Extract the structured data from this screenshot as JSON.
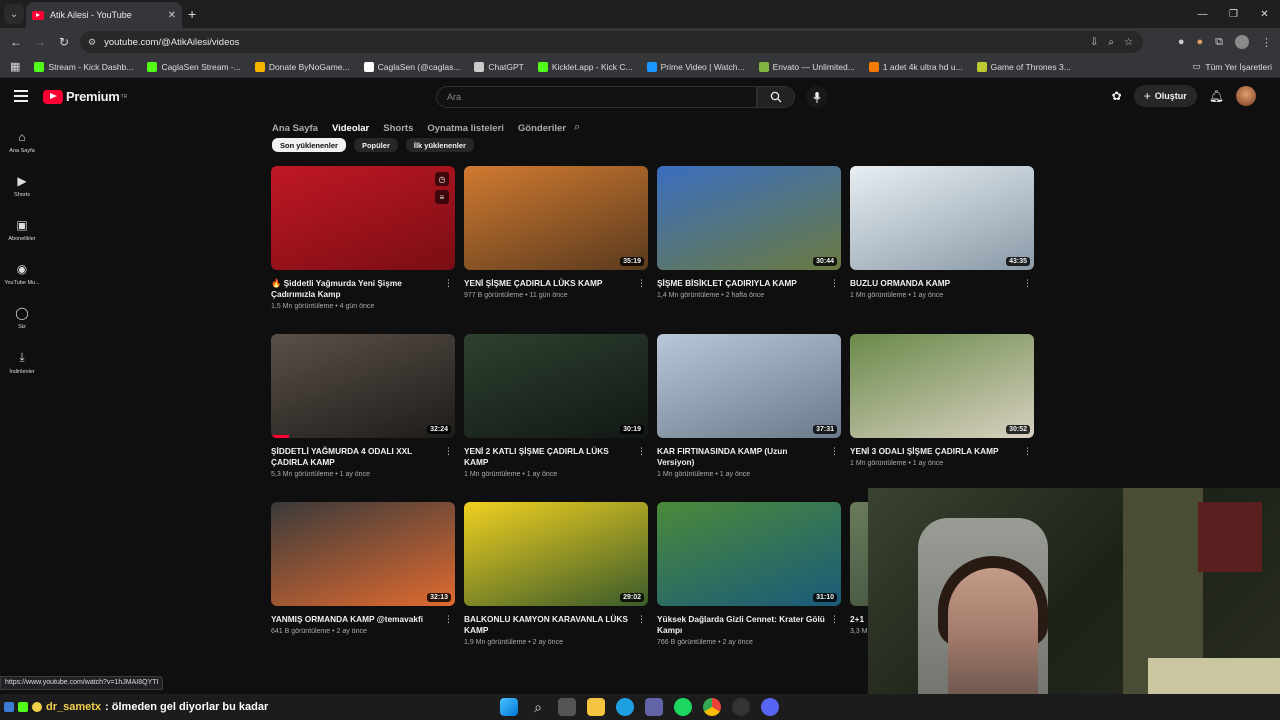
{
  "browser": {
    "tab_title": "Atik Ailesi - YouTube",
    "new_tab": "+",
    "url": "youtube.com/@AtikAilesi/videos",
    "bookmarks": [
      {
        "label": "Stream - Kick Dashb...",
        "color": "#53fc18"
      },
      {
        "label": "CaglaSen Stream -...",
        "color": "#53fc18"
      },
      {
        "label": "Donate ByNoGame...",
        "color": "#f5b400"
      },
      {
        "label": "CaglaSen (@caglas...",
        "color": "#ffffff"
      },
      {
        "label": "ChatGPT",
        "color": "#cccccc"
      },
      {
        "label": "Kicklet.app - Kick C...",
        "color": "#53fc18"
      },
      {
        "label": "Prime Video | Watch...",
        "color": "#1a98ff"
      },
      {
        "label": "Envato — Unlimited...",
        "color": "#82b541"
      },
      {
        "label": "1 adet 4k ultra hd u...",
        "color": "#f57c00"
      },
      {
        "label": "Game of Thrones 3...",
        "color": "#c0ca33"
      }
    ],
    "all_bookmarks": "Tüm Yer İşaretleri"
  },
  "yt": {
    "logo_text": "Premium",
    "logo_sup": "TR",
    "search_placeholder": "Ara",
    "create_label": "Oluştur",
    "guide": [
      {
        "label": "Ana Sayfa",
        "icon": "home-icon"
      },
      {
        "label": "Shorts",
        "icon": "shorts-icon"
      },
      {
        "label": "Abonelikler",
        "icon": "subscriptions-icon"
      },
      {
        "label": "YouTube Mu...",
        "icon": "music-icon"
      },
      {
        "label": "Siz",
        "icon": "you-icon"
      },
      {
        "label": "İndirilenler",
        "icon": "download-icon"
      }
    ],
    "channel_tabs": [
      "Ana Sayfa",
      "Videolar",
      "Shorts",
      "Oynatma listeleri",
      "Gönderiler"
    ],
    "active_tab": "Videolar",
    "chips": [
      "Son yüklenenler",
      "Popüler",
      "İlk yüklenenler"
    ],
    "videos": [
      {
        "title": "🔥 Şiddetli Yağmurda Yeni Şişme Çadırımızla Kamp",
        "views": "1,5 Mn görüntüleme",
        "age": "4 gün önce",
        "duration": "",
        "colors": [
          "#c01824",
          "#7a0d14"
        ]
      },
      {
        "title": "YENİ ŞİŞME ÇADIRLA LÜKS KAMP",
        "views": "977 B görüntüleme",
        "age": "11 gün önce",
        "duration": "35:19",
        "colors": [
          "#d07a30",
          "#5a3a1e"
        ]
      },
      {
        "title": "ŞİŞME BİSİKLET ÇADIRIYLA KAMP",
        "views": "1,4 Mn görüntüleme",
        "age": "2 hafta önce",
        "duration": "30:44",
        "colors": [
          "#3a6ec0",
          "#6b7a40"
        ]
      },
      {
        "title": "BUZLU ORMANDA KAMP",
        "views": "1 Mn görüntüleme",
        "age": "1 ay önce",
        "duration": "43:35",
        "colors": [
          "#e8eef2",
          "#8a9aa8"
        ]
      },
      {
        "title": "ŞİDDETLİ YAĞMURDA 4 ODALI XXL ÇADIRLA KAMP",
        "views": "5,3 Mn görüntüleme",
        "age": "1 ay önce",
        "duration": "32:24",
        "colors": [
          "#5a5048",
          "#1e1c1a"
        ],
        "progress": 0.1
      },
      {
        "title": "YENİ 2 KATLI ŞİŞME ÇADIRLA LÜKS KAMP",
        "views": "1 Mn görüntüleme",
        "age": "1 ay önce",
        "duration": "30:19",
        "colors": [
          "#2e4030",
          "#121814"
        ]
      },
      {
        "title": "KAR FIRTINASINDA KAMP (Uzun Versiyon)",
        "views": "1 Mn görüntüleme",
        "age": "1 ay önce",
        "duration": "37:31",
        "colors": [
          "#b8c8d8",
          "#6a7a8a"
        ]
      },
      {
        "title": "YENİ 3 ODALI ŞİŞME ÇADIRLA KAMP",
        "views": "1 Mn görüntüleme",
        "age": "1 ay önce",
        "duration": "30:52",
        "colors": [
          "#6a8a4a",
          "#d8d0c0"
        ]
      },
      {
        "title": "YANMIŞ ORMANDA KAMP @temavakfi",
        "views": "641 B görüntüleme",
        "age": "2 ay önce",
        "duration": "32:13",
        "colors": [
          "#3a3a3a",
          "#e06a30"
        ]
      },
      {
        "title": "BALKONLU KAMYON KARAVANLA LÜKS KAMP",
        "views": "1,9 Mn görüntüleme",
        "age": "2 ay önce",
        "duration": "29:02",
        "colors": [
          "#f0d020",
          "#3a5a2a"
        ]
      },
      {
        "title": "Yüksek Dağlarda Gizli Cennet: Krater Gölü Kampı",
        "views": "766 B görüntüleme",
        "age": "2 ay önce",
        "duration": "31:10",
        "colors": [
          "#4a8a3a",
          "#1a5a7a"
        ]
      },
      {
        "title": "2+1",
        "views": "3,3 M",
        "age": "",
        "duration": "",
        "colors": [
          "#6a7a5a",
          "#3a4a3a"
        ]
      }
    ]
  },
  "status_url": "https://www.youtube.com/watch?v=1hJMAI8QYTI",
  "chat": {
    "user": "dr_sametx",
    "message": ": ölmeden gel diyorlar bu kadar"
  }
}
